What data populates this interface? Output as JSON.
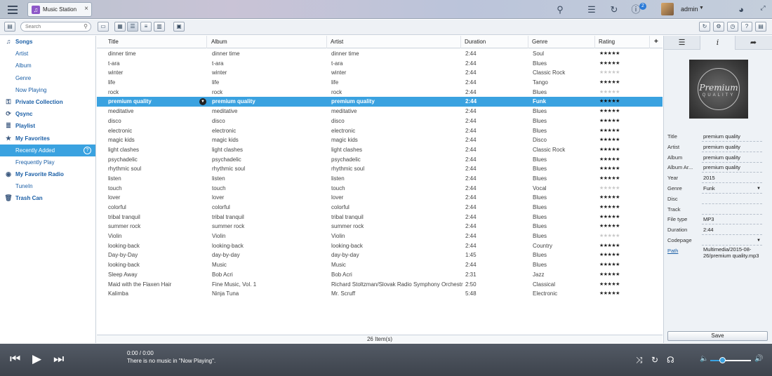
{
  "app": {
    "tab_title": "Music Station",
    "tab_icon": "music-note-icon",
    "tab_close": "×"
  },
  "topbar": {
    "user": "admin",
    "badge": "2",
    "icons": [
      "search-icon",
      "stack-icon",
      "sync-icon",
      "info-icon",
      "dashboard-icon"
    ]
  },
  "toolbar": {
    "search_placeholder": "Search",
    "accent": "#3aa2e0"
  },
  "sidebar": {
    "items": [
      {
        "label": "Songs",
        "icon": "music-note-icon",
        "top": true
      },
      {
        "label": "Artist"
      },
      {
        "label": "Album"
      },
      {
        "label": "Genre"
      },
      {
        "label": "Now Playing"
      },
      {
        "label": "Private Collection",
        "icon": "lock-icon",
        "top": true
      },
      {
        "label": "Qsync",
        "icon": "qsync-icon",
        "top": true
      },
      {
        "label": "Playlist",
        "icon": "playlist-icon",
        "top": true
      },
      {
        "label": "My Favorites",
        "icon": "star-icon",
        "top": true
      },
      {
        "label": "Recently Added",
        "selected": true
      },
      {
        "label": "Frequently Play"
      },
      {
        "label": "My Favorite Radio",
        "icon": "radio-icon",
        "top": true
      },
      {
        "label": "TuneIn"
      },
      {
        "label": "Trash Can",
        "icon": "trash-icon",
        "top": true
      }
    ]
  },
  "table": {
    "columns": [
      "Title",
      "Album",
      "Artist",
      "Duration",
      "Genre",
      "Rating"
    ],
    "add_column": "+",
    "rows": [
      {
        "title": "dinner time",
        "album": "dinner time",
        "artist": "dinner time",
        "duration": "2:44",
        "genre": "Soul",
        "rating": 5
      },
      {
        "title": "t-ara",
        "album": "t-ara",
        "artist": "t-ara",
        "duration": "2:44",
        "genre": "Blues",
        "rating": 5
      },
      {
        "title": "winter",
        "album": "winter",
        "artist": "winter",
        "duration": "2:44",
        "genre": "Classic Rock",
        "rating": 0
      },
      {
        "title": "life",
        "album": "life",
        "artist": "life",
        "duration": "2:44",
        "genre": "Tango",
        "rating": 5
      },
      {
        "title": "rock",
        "album": "rock",
        "artist": "rock",
        "duration": "2:44",
        "genre": "Blues",
        "rating": 0
      },
      {
        "title": "premium quality",
        "album": "premium quality",
        "artist": "premium quality",
        "duration": "2:44",
        "genre": "Funk",
        "rating": 5,
        "selected": true
      },
      {
        "title": "meditative",
        "album": "meditative",
        "artist": "meditative",
        "duration": "2:44",
        "genre": "Blues",
        "rating": 5
      },
      {
        "title": "disco",
        "album": "disco",
        "artist": "disco",
        "duration": "2:44",
        "genre": "Blues",
        "rating": 5
      },
      {
        "title": "electronic",
        "album": "electronic",
        "artist": "electronic",
        "duration": "2:44",
        "genre": "Blues",
        "rating": 5
      },
      {
        "title": "magic kids",
        "album": "magic kids",
        "artist": "magic kids",
        "duration": "2:44",
        "genre": "Disco",
        "rating": 5
      },
      {
        "title": "light clashes",
        "album": "light clashes",
        "artist": "light clashes",
        "duration": "2:44",
        "genre": "Classic Rock",
        "rating": 5
      },
      {
        "title": "psychadelic",
        "album": "psychadelic",
        "artist": "psychadelic",
        "duration": "2:44",
        "genre": "Blues",
        "rating": 5
      },
      {
        "title": "rhythmic soul",
        "album": "rhythmic soul",
        "artist": "rhythmic soul",
        "duration": "2:44",
        "genre": "Blues",
        "rating": 5
      },
      {
        "title": "listen",
        "album": "listen",
        "artist": "listen",
        "duration": "2:44",
        "genre": "Blues",
        "rating": 5
      },
      {
        "title": "touch",
        "album": "touch",
        "artist": "touch",
        "duration": "2:44",
        "genre": "Vocal",
        "rating": 0
      },
      {
        "title": "lover",
        "album": "lover",
        "artist": "lover",
        "duration": "2:44",
        "genre": "Blues",
        "rating": 5
      },
      {
        "title": "colorful",
        "album": "colorful",
        "artist": "colorful",
        "duration": "2:44",
        "genre": "Blues",
        "rating": 5
      },
      {
        "title": "tribal tranquil",
        "album": "tribal tranquil",
        "artist": "tribal tranquil",
        "duration": "2:44",
        "genre": "Blues",
        "rating": 5
      },
      {
        "title": "summer rock",
        "album": "summer rock",
        "artist": "summer rock",
        "duration": "2:44",
        "genre": "Blues",
        "rating": 5
      },
      {
        "title": "Violin",
        "album": "Violin",
        "artist": "Violin",
        "duration": "2:44",
        "genre": "Blues",
        "rating": 0
      },
      {
        "title": "looking-back",
        "album": "looking-back",
        "artist": "looking-back",
        "duration": "2:44",
        "genre": "Country",
        "rating": 5
      },
      {
        "title": "Day-by-Day",
        "album": "day-by-day",
        "artist": "day-by-day",
        "duration": "1:45",
        "genre": "Blues",
        "rating": 5
      },
      {
        "title": "looking-back",
        "album": "Music",
        "artist": "Music",
        "duration": "2:44",
        "genre": "Blues",
        "rating": 5
      },
      {
        "title": "Sleep Away",
        "album": "Bob Acri",
        "artist": "Bob Acri",
        "duration": "2:31",
        "genre": "Jazz",
        "rating": 5
      },
      {
        "title": "Maid with the Flaxen Hair",
        "album": "Fine Music, Vol. 1",
        "artist": "Richard Stoltzman/Slovak Radio Symphony Orchestra",
        "duration": "2:50",
        "genre": "Classical",
        "rating": 5
      },
      {
        "title": "Kalimba",
        "album": "Ninja Tuna",
        "artist": "Mr. Scruff",
        "duration": "5:48",
        "genre": "Electronic",
        "rating": 5
      }
    ],
    "footer": "26 Item(s)"
  },
  "panel": {
    "cover_title": "Premium",
    "cover_sub": "QUALITY",
    "fields": [
      {
        "label": "Title",
        "value": "premium quality"
      },
      {
        "label": "Artist",
        "value": "premium quality"
      },
      {
        "label": "Album",
        "value": "premium quality"
      },
      {
        "label": "Album Ar...",
        "value": "premium quality"
      },
      {
        "label": "Year",
        "value": "2015"
      },
      {
        "label": "Genre",
        "value": "Funk",
        "dropdown": true
      },
      {
        "label": "Disc",
        "value": ""
      },
      {
        "label": "Track",
        "value": ""
      },
      {
        "label": "File type",
        "value": "MP3"
      },
      {
        "label": "Duration",
        "value": "2:44"
      },
      {
        "label": "Codepage",
        "value": "",
        "dropdown": true
      },
      {
        "label": "Path",
        "value": "Multimedia/2015-08-26/premium quality.mp3",
        "link": true
      }
    ],
    "save_label": "Save"
  },
  "player": {
    "time": "0:00 / 0:00",
    "message": "There is no music in \"Now Playing\".",
    "volume": 0.3
  }
}
